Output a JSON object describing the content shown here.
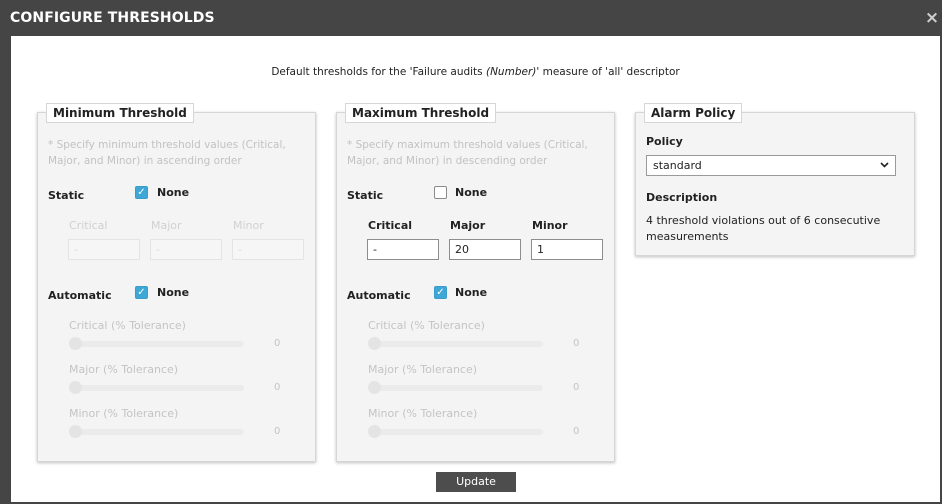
{
  "dialog": {
    "title": "CONFIGURE THRESHOLDS",
    "close_label": "×",
    "subtitle_prefix": "Default thresholds for the 'Failure audits ",
    "subtitle_measure": "(Number)'",
    "subtitle_suffix": " measure of 'all' descriptor"
  },
  "minimum": {
    "legend": "Minimum Threshold",
    "note": "* Specify minimum threshold values (Critical, Major, and Minor) in ascending order",
    "static_label": "Static",
    "static_none_checked": true,
    "none_label": "None",
    "columns": [
      "Critical",
      "Major",
      "Minor"
    ],
    "inputs": [
      "-",
      "-",
      "-"
    ],
    "automatic_label": "Automatic",
    "automatic_none_checked": true,
    "tolerances": [
      {
        "label": "Critical (% Tolerance)",
        "value": "0"
      },
      {
        "label": "Major (% Tolerance)",
        "value": "0"
      },
      {
        "label": "Minor (% Tolerance)",
        "value": "0"
      }
    ]
  },
  "maximum": {
    "legend": "Maximum Threshold",
    "note": "* Specify maximum threshold values (Critical, Major, and Minor) in descending order",
    "static_label": "Static",
    "static_none_checked": false,
    "none_label": "None",
    "columns": [
      "Critical",
      "Major",
      "Minor"
    ],
    "inputs": [
      "-",
      "20",
      "1"
    ],
    "automatic_label": "Automatic",
    "automatic_none_checked": true,
    "tolerances": [
      {
        "label": "Critical (% Tolerance)",
        "value": "0"
      },
      {
        "label": "Major (% Tolerance)",
        "value": "0"
      },
      {
        "label": "Minor (% Tolerance)",
        "value": "0"
      }
    ]
  },
  "alarm": {
    "legend": "Alarm Policy",
    "policy_label": "Policy",
    "policy_value": "standard",
    "description_label": "Description",
    "description_text": "4 threshold violations out of 6 consecutive measurements"
  },
  "actions": {
    "update_label": "Update"
  },
  "colors": {
    "checkbox_checked": "#3fa7d6",
    "titlebar": "#454545",
    "update_button": "#4d4d4d"
  },
  "icons": {
    "close": "close-icon",
    "check": "check-icon",
    "dropdown": "chevron-down-icon"
  }
}
